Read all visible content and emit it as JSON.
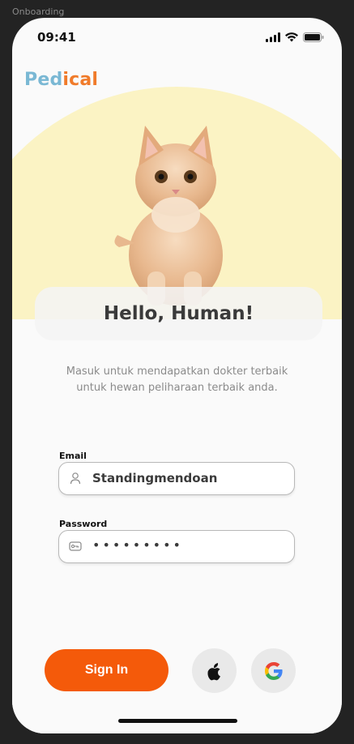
{
  "frame": {
    "label": "Onboarding"
  },
  "status_bar": {
    "time": "09:41"
  },
  "brand": {
    "part1": "Ped",
    "part2": "ical"
  },
  "hero": {
    "greeting": "Hello, Human!"
  },
  "subtitle": "Masuk untuk mendapatkan dokter terbaik untuk hewan peliharaan terbaik anda.",
  "form": {
    "email_label": "Email",
    "email_value": "Standingmendoan",
    "password_label": "Password",
    "password_masked": "•••••••••"
  },
  "actions": {
    "signin_label": "Sign In"
  },
  "colors": {
    "accent": "#f45a0a",
    "brand_blue": "#7ab8d4",
    "brand_orange": "#f07b2a",
    "hero_bg": "#fbf3c4"
  },
  "icons": [
    "signal-icon",
    "wifi-icon",
    "battery-icon",
    "user-icon",
    "key-icon",
    "apple-icon",
    "google-icon"
  ]
}
